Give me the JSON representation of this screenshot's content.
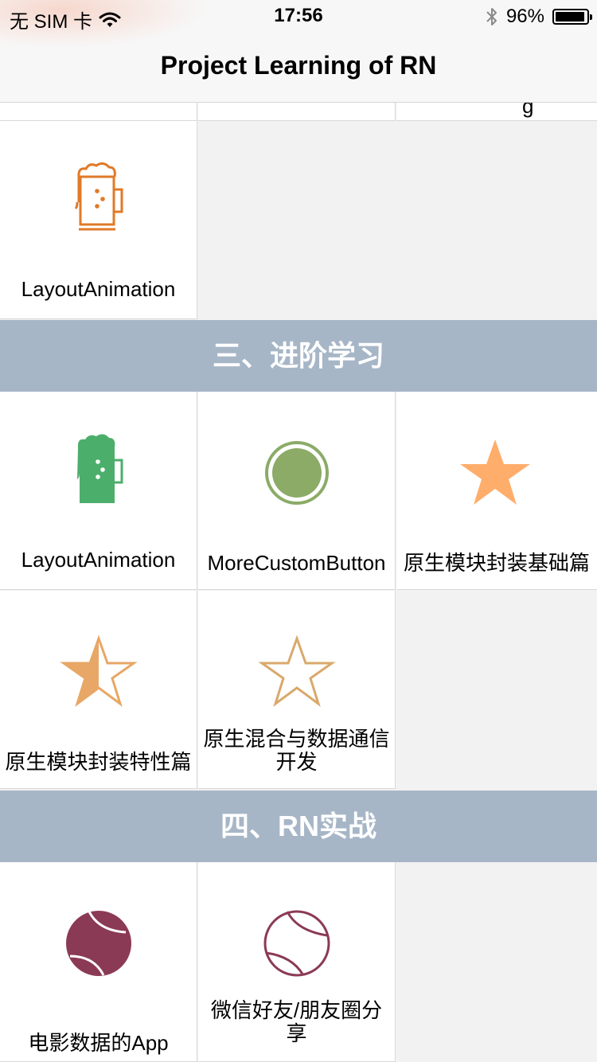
{
  "status_bar": {
    "carrier": "无 SIM 卡",
    "time": "17:56",
    "battery": "96%",
    "battery_level": 0.96
  },
  "nav": {
    "title": "Project Learning of RN"
  },
  "sections": [
    {
      "title": "三、进阶学习"
    },
    {
      "title": "四、RN实战"
    }
  ],
  "cells": {
    "top_layout_animation": {
      "label": "LayoutAnimation",
      "icon": "beer-outline-icon",
      "color": "#e07a28"
    },
    "adv_layout_animation": {
      "label": "LayoutAnimation",
      "icon": "beer-filled-icon",
      "color": "#4cae6b"
    },
    "more_custom_button": {
      "label": "MoreCustomButton",
      "icon": "circle-button-icon",
      "color": "#8bab67"
    },
    "native_module_basics": {
      "label": "原生模块封装基础篇",
      "icon": "star-filled-icon",
      "color": "#ffad6b"
    },
    "native_module_features": {
      "label": "原生模块封装特性篇",
      "icon": "star-half-icon",
      "color": "#e8a766"
    },
    "native_hybrid_data": {
      "label": "原生混合与数据通信开发",
      "icon": "star-outline-icon",
      "color": "#d9a96b"
    },
    "movie_data_app": {
      "label": "电影数据的App",
      "icon": "tennis-ball-filled-icon",
      "color": "#8b3a55"
    },
    "wechat_share": {
      "label": "微信好友/朋友圈分享",
      "icon": "tennis-ball-outline-icon",
      "color": "#8b3a55"
    }
  }
}
